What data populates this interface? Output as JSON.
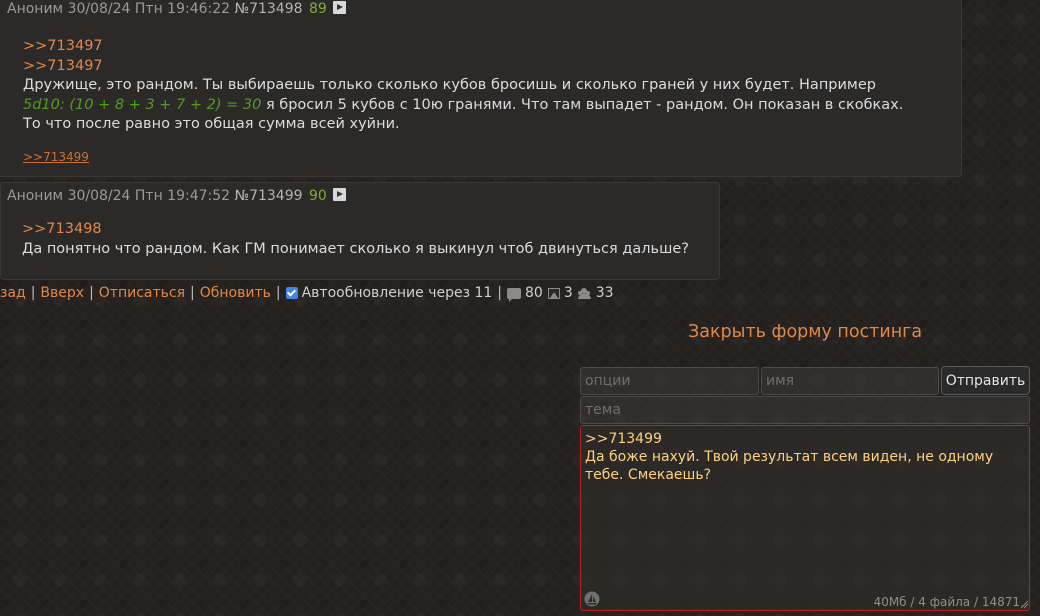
{
  "posts": [
    {
      "author": "Аноним",
      "date": "30/08/24 Птн 19:46:22",
      "number": "№713498",
      "index": "89",
      "lines": {
        "ref1": ">>713497",
        "ref2": ">>713497",
        "text1": "Дружище, это рандом. Ты выбираешь только сколько кубов бросишь и сколько граней у них будет. Например",
        "dice": "5d10: (10 + 8 + 3 + 7 + 2) = 30",
        "text2": " я бросил 5 кубов с 10ю гранями. Что там выпадет - рандом. Он показан в скобках.",
        "text3": "То что после равно это общая сумма всей хуйни."
      },
      "reply": ">>713499"
    },
    {
      "author": "Аноним",
      "date": "30/08/24 Птн 19:47:52",
      "number": "№713499",
      "index": "90",
      "lines": {
        "ref1": ">>713498",
        "text1": "Да понятно что рандом. Как ГМ понимает сколько я выкинул чтоб двинуться дальше?"
      }
    }
  ],
  "nav": {
    "back": "зад",
    "sep": "|",
    "up": "Вверх",
    "unsubscribe": "Отписаться",
    "refresh": "Обновить",
    "autoupdate": "Автообновление через 11",
    "posts_count": "80",
    "images_count": "3",
    "users_count": "33"
  },
  "form": {
    "close_label": "Закрыть форму постинга",
    "options_placeholder": "опции",
    "name_placeholder": "имя",
    "submit_label": "Отправить",
    "subject_placeholder": "тема",
    "comment_value": ">>713499\nДа боже нахуй. Твой результат всем виден, не одному тебе. Смекаешь?",
    "meta": "40Мб / 4 файла / 14871"
  }
}
